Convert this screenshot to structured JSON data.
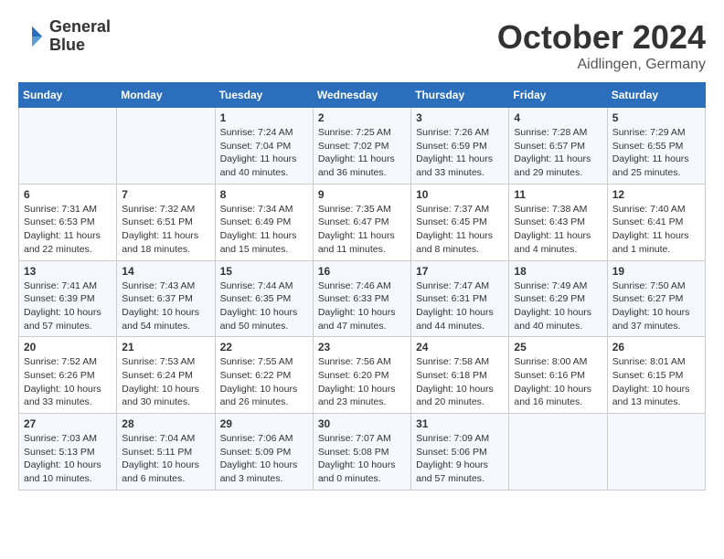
{
  "header": {
    "logo_line1": "General",
    "logo_line2": "Blue",
    "month": "October 2024",
    "location": "Aidlingen, Germany"
  },
  "columns": [
    "Sunday",
    "Monday",
    "Tuesday",
    "Wednesday",
    "Thursday",
    "Friday",
    "Saturday"
  ],
  "weeks": [
    [
      {
        "day": "",
        "info": ""
      },
      {
        "day": "",
        "info": ""
      },
      {
        "day": "1",
        "info": "Sunrise: 7:24 AM\nSunset: 7:04 PM\nDaylight: 11 hours and 40 minutes."
      },
      {
        "day": "2",
        "info": "Sunrise: 7:25 AM\nSunset: 7:02 PM\nDaylight: 11 hours and 36 minutes."
      },
      {
        "day": "3",
        "info": "Sunrise: 7:26 AM\nSunset: 6:59 PM\nDaylight: 11 hours and 33 minutes."
      },
      {
        "day": "4",
        "info": "Sunrise: 7:28 AM\nSunset: 6:57 PM\nDaylight: 11 hours and 29 minutes."
      },
      {
        "day": "5",
        "info": "Sunrise: 7:29 AM\nSunset: 6:55 PM\nDaylight: 11 hours and 25 minutes."
      }
    ],
    [
      {
        "day": "6",
        "info": "Sunrise: 7:31 AM\nSunset: 6:53 PM\nDaylight: 11 hours and 22 minutes."
      },
      {
        "day": "7",
        "info": "Sunrise: 7:32 AM\nSunset: 6:51 PM\nDaylight: 11 hours and 18 minutes."
      },
      {
        "day": "8",
        "info": "Sunrise: 7:34 AM\nSunset: 6:49 PM\nDaylight: 11 hours and 15 minutes."
      },
      {
        "day": "9",
        "info": "Sunrise: 7:35 AM\nSunset: 6:47 PM\nDaylight: 11 hours and 11 minutes."
      },
      {
        "day": "10",
        "info": "Sunrise: 7:37 AM\nSunset: 6:45 PM\nDaylight: 11 hours and 8 minutes."
      },
      {
        "day": "11",
        "info": "Sunrise: 7:38 AM\nSunset: 6:43 PM\nDaylight: 11 hours and 4 minutes."
      },
      {
        "day": "12",
        "info": "Sunrise: 7:40 AM\nSunset: 6:41 PM\nDaylight: 11 hours and 1 minute."
      }
    ],
    [
      {
        "day": "13",
        "info": "Sunrise: 7:41 AM\nSunset: 6:39 PM\nDaylight: 10 hours and 57 minutes."
      },
      {
        "day": "14",
        "info": "Sunrise: 7:43 AM\nSunset: 6:37 PM\nDaylight: 10 hours and 54 minutes."
      },
      {
        "day": "15",
        "info": "Sunrise: 7:44 AM\nSunset: 6:35 PM\nDaylight: 10 hours and 50 minutes."
      },
      {
        "day": "16",
        "info": "Sunrise: 7:46 AM\nSunset: 6:33 PM\nDaylight: 10 hours and 47 minutes."
      },
      {
        "day": "17",
        "info": "Sunrise: 7:47 AM\nSunset: 6:31 PM\nDaylight: 10 hours and 44 minutes."
      },
      {
        "day": "18",
        "info": "Sunrise: 7:49 AM\nSunset: 6:29 PM\nDaylight: 10 hours and 40 minutes."
      },
      {
        "day": "19",
        "info": "Sunrise: 7:50 AM\nSunset: 6:27 PM\nDaylight: 10 hours and 37 minutes."
      }
    ],
    [
      {
        "day": "20",
        "info": "Sunrise: 7:52 AM\nSunset: 6:26 PM\nDaylight: 10 hours and 33 minutes."
      },
      {
        "day": "21",
        "info": "Sunrise: 7:53 AM\nSunset: 6:24 PM\nDaylight: 10 hours and 30 minutes."
      },
      {
        "day": "22",
        "info": "Sunrise: 7:55 AM\nSunset: 6:22 PM\nDaylight: 10 hours and 26 minutes."
      },
      {
        "day": "23",
        "info": "Sunrise: 7:56 AM\nSunset: 6:20 PM\nDaylight: 10 hours and 23 minutes."
      },
      {
        "day": "24",
        "info": "Sunrise: 7:58 AM\nSunset: 6:18 PM\nDaylight: 10 hours and 20 minutes."
      },
      {
        "day": "25",
        "info": "Sunrise: 8:00 AM\nSunset: 6:16 PM\nDaylight: 10 hours and 16 minutes."
      },
      {
        "day": "26",
        "info": "Sunrise: 8:01 AM\nSunset: 6:15 PM\nDaylight: 10 hours and 13 minutes."
      }
    ],
    [
      {
        "day": "27",
        "info": "Sunrise: 7:03 AM\nSunset: 5:13 PM\nDaylight: 10 hours and 10 minutes."
      },
      {
        "day": "28",
        "info": "Sunrise: 7:04 AM\nSunset: 5:11 PM\nDaylight: 10 hours and 6 minutes."
      },
      {
        "day": "29",
        "info": "Sunrise: 7:06 AM\nSunset: 5:09 PM\nDaylight: 10 hours and 3 minutes."
      },
      {
        "day": "30",
        "info": "Sunrise: 7:07 AM\nSunset: 5:08 PM\nDaylight: 10 hours and 0 minutes."
      },
      {
        "day": "31",
        "info": "Sunrise: 7:09 AM\nSunset: 5:06 PM\nDaylight: 9 hours and 57 minutes."
      },
      {
        "day": "",
        "info": ""
      },
      {
        "day": "",
        "info": ""
      }
    ]
  ]
}
